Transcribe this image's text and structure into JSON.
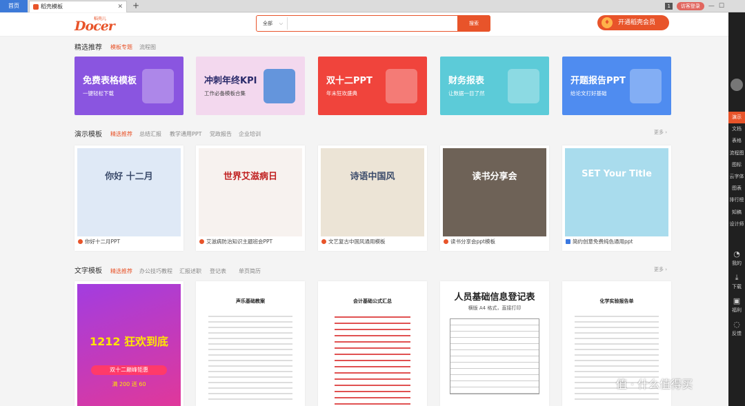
{
  "browser": {
    "home_tab": "首页",
    "doc_tab": "稻壳模板",
    "tab_badge": "1",
    "login": "访客登录"
  },
  "header": {
    "logo_text": "Docer",
    "logo_sub": "稻壳儿",
    "search_category": "全部",
    "search_placeholder": "",
    "search_button": "搜索",
    "vip_button": "开通稻壳会员"
  },
  "sidebar": {
    "items": [
      "演示",
      "文档",
      "表格",
      "流程图",
      "图标",
      "云字体",
      "图表",
      "排行榜",
      "知稿",
      "设计师"
    ],
    "active": "演示",
    "bottom": [
      {
        "label": "我的",
        "icon": "user-icon"
      },
      {
        "label": "下载",
        "icon": "download-icon"
      },
      {
        "label": "福利",
        "icon": "gift-icon"
      },
      {
        "label": "反馈",
        "icon": "chat-icon"
      }
    ]
  },
  "featured": {
    "title": "精选推荐",
    "tabs": [
      "模板专题",
      "流程图"
    ],
    "banners": [
      {
        "title": "免费表格模板",
        "sub": "一键轻松下载",
        "bg": "#8a55e0"
      },
      {
        "title": "冲刺年终KPI",
        "sub": "工作必备模板合集",
        "bg": "#f3d8ee"
      },
      {
        "title": "双十二PPT",
        "sub": "年末狂欢盛典",
        "bg": "#f0443c"
      },
      {
        "title": "财务报表",
        "sub": "让数据一目了然",
        "bg": "#5ccbd8"
      },
      {
        "title": "开题报告PPT",
        "sub": "给论文打好基础",
        "bg": "#4f8cf0"
      }
    ]
  },
  "ppt": {
    "title": "演示模板",
    "tabs": [
      "精选推荐",
      "总结汇报",
      "教学通用PPT",
      "党政报告",
      "企业培训"
    ],
    "more": "更多 ›",
    "cards": [
      {
        "caption": "你好十二月PPT",
        "thumb_text": "你好 十二月",
        "bg": "#dfe9f6"
      },
      {
        "caption": "艾滋病防治知识主题班会PPT",
        "thumb_text": "世界艾滋病日",
        "bg": "#f7f2ef"
      },
      {
        "caption": "文艺复古中国风通用模板",
        "thumb_text": "诗语中国风",
        "bg": "#ece4d6"
      },
      {
        "caption": "读书分享会ppt模板",
        "thumb_text": "读书分享会",
        "bg": "#6e6257"
      },
      {
        "caption": "简约创意免费纯色通用ppt",
        "thumb_text": "SET Your Title",
        "bg": "#a9dced"
      }
    ]
  },
  "text": {
    "title": "文字模板",
    "tabs": [
      "精选推荐",
      "办公技巧教程",
      "汇报述职",
      "登记表",
      "单页简历"
    ],
    "more": "更多 ›",
    "cards": [
      {
        "thumb_text": "1212 狂欢到底",
        "thumb_sub": "双十二巅峰钜惠",
        "thumb_sub2": "满 200 送 60"
      },
      {
        "thumb_text": "声乐基础教案"
      },
      {
        "thumb_text": "会计基础公式汇总"
      },
      {
        "thumb_text": "人员基础信息登记表",
        "thumb_sub": "横版 A4 格式，直接打印"
      },
      {
        "thumb_text": "化学实验报告单"
      }
    ]
  },
  "watermark": "值 · 什么值得买"
}
